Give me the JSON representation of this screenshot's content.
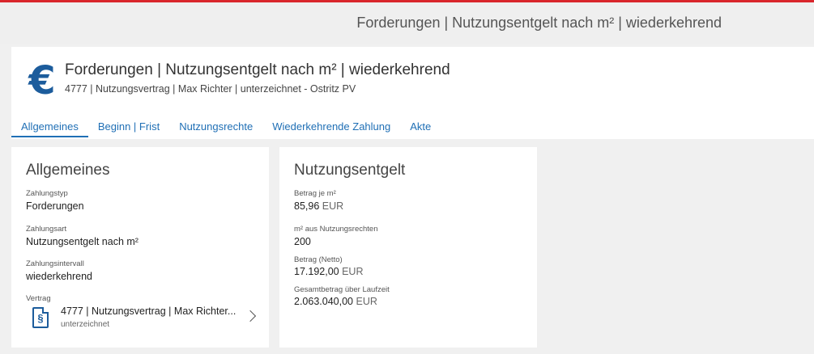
{
  "topbar": {
    "title": "Forderungen | Nutzungsentgelt nach m² | wiederkehrend"
  },
  "header": {
    "icon": "euro-icon",
    "title": "Forderungen | Nutzungsentgelt nach m² | wiederkehrend",
    "subtitle": "4777 | Nutzungsvertrag | Max Richter | unterzeichnet - Ostritz PV"
  },
  "tabs": [
    {
      "label": "Allgemeines",
      "active": true
    },
    {
      "label": "Beginn | Frist",
      "active": false
    },
    {
      "label": "Nutzungsrechte",
      "active": false
    },
    {
      "label": "Wiederkehrende Zahlung",
      "active": false
    },
    {
      "label": "Akte",
      "active": false
    }
  ],
  "general": {
    "title": "Allgemeines",
    "zahlungstyp_label": "Zahlungstyp",
    "zahlungstyp_value": "Forderungen",
    "zahlungsart_label": "Zahlungsart",
    "zahlungsart_value": "Nutzungsentgelt nach m²",
    "intervall_label": "Zahlungsintervall",
    "intervall_value": "wiederkehrend",
    "vertrag_label": "Vertrag",
    "vertrag_value": "4777 | Nutzungsvertrag | Max Richter...",
    "vertrag_status": "unterzeichnet",
    "vertrag_icon": "contract-document-icon"
  },
  "fee": {
    "title": "Nutzungsentgelt",
    "betrag_je_label": "Betrag je m²",
    "betrag_je_value": "85,96",
    "betrag_je_unit": "EUR",
    "m2_label": "m² aus Nutzungsrechten",
    "m2_value": "200",
    "netto_label": "Betrag (Netto)",
    "netto_value": "17.192,00",
    "netto_unit": "EUR",
    "gesamt_label": "Gesamtbetrag über Laufzeit",
    "gesamt_value": "2.063.040,00",
    "gesamt_unit": "EUR"
  },
  "colors": {
    "accent": "#1f6fb5",
    "brand_red": "#d9262c",
    "icon_blue": "#1c5c9c"
  }
}
